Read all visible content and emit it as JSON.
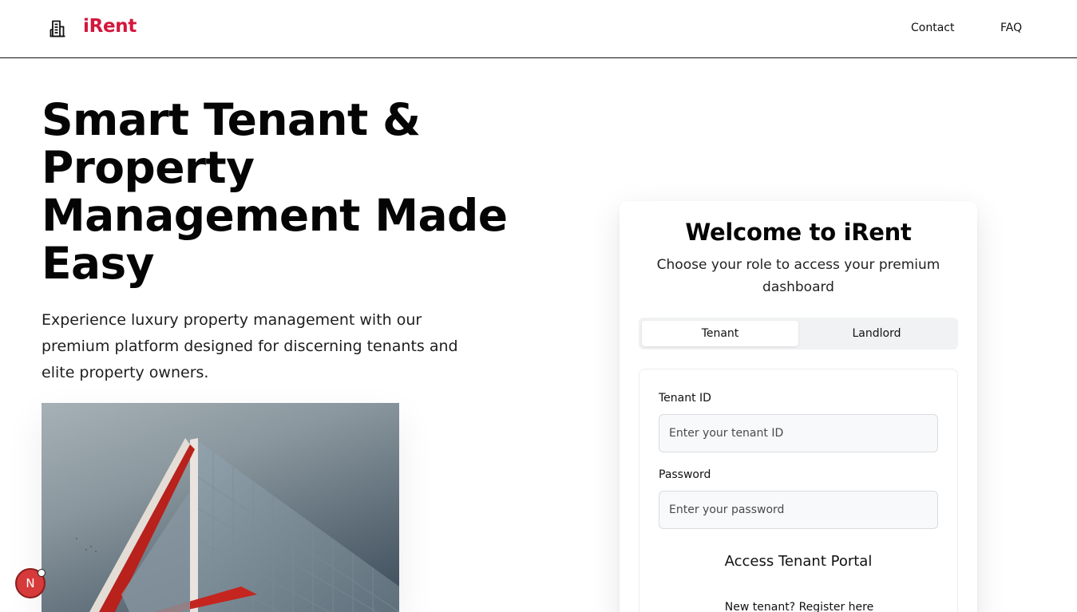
{
  "header": {
    "brand": "iRent",
    "nav": [
      {
        "label": "Contact"
      },
      {
        "label": "FAQ"
      }
    ]
  },
  "hero": {
    "title": "Smart Tenant & Property Management Made Easy",
    "subtitle": "Experience luxury property management with our premium platform designed for discerning tenants and elite property owners."
  },
  "card": {
    "title": "Welcome to iRent",
    "subtitle": "Choose your role to access your premium dashboard",
    "tabs": [
      {
        "label": "Tenant",
        "active": true
      },
      {
        "label": "Landlord",
        "active": false
      }
    ],
    "form": {
      "id_label": "Tenant ID",
      "id_placeholder": "Enter your tenant ID",
      "password_label": "Password",
      "password_placeholder": "Enter your password",
      "submit_label": "Access Tenant Portal",
      "register_text": "New tenant? Register here"
    }
  },
  "floating_badge": {
    "letter": "N"
  },
  "colors": {
    "brand": "#d3173c",
    "text": "#111111",
    "tab_bg": "#f1f2f4",
    "input_bg": "#f8f9fa"
  },
  "icons": {
    "logo": "building-icon"
  }
}
